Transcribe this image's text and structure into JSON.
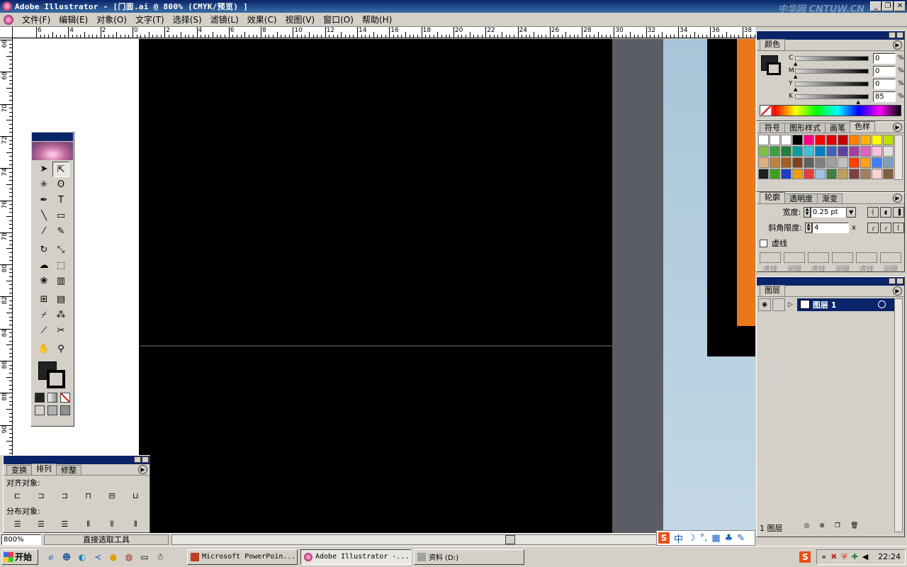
{
  "window": {
    "title": "Adobe Illustrator - [门面.ai @ 800% (CMYK/预览) ]",
    "watermark": "中华网 CNTUW.CN",
    "btn_min": "_",
    "btn_restore": "❐",
    "btn_close": "✕"
  },
  "menu": {
    "items": [
      {
        "label": "文件(F)"
      },
      {
        "label": "编辑(E)"
      },
      {
        "label": "对象(O)"
      },
      {
        "label": "文字(T)"
      },
      {
        "label": "选择(S)"
      },
      {
        "label": "滤镜(L)"
      },
      {
        "label": "效果(C)"
      },
      {
        "label": "视图(V)"
      },
      {
        "label": "窗口(O)"
      },
      {
        "label": "帮助(H)"
      }
    ]
  },
  "ruler_top": [
    "6",
    "4",
    "2",
    "0",
    "2",
    "4",
    "6",
    "8",
    "10",
    "12",
    "14",
    "16",
    "18",
    "20",
    "22",
    "24",
    "26",
    "28",
    "30",
    "32",
    "34",
    "36",
    "38"
  ],
  "ruler_left": [
    "66",
    "68",
    "70",
    "72",
    "74",
    "76",
    "78",
    "80",
    "82",
    "84",
    "86",
    "88",
    "90"
  ],
  "toolbox": {
    "tools": [
      {
        "name": "selection-tool",
        "glyph": "➤"
      },
      {
        "name": "direct-selection-tool",
        "glyph": "⇱"
      },
      {
        "name": "magic-wand-tool",
        "glyph": "✳"
      },
      {
        "name": "lasso-tool",
        "glyph": "ʘ"
      },
      {
        "name": "pen-tool",
        "glyph": "✒"
      },
      {
        "name": "type-tool",
        "glyph": "T"
      },
      {
        "name": "line-tool",
        "glyph": "╲"
      },
      {
        "name": "rectangle-tool",
        "glyph": "▭"
      },
      {
        "name": "paintbrush-tool",
        "glyph": "⁄"
      },
      {
        "name": "pencil-tool",
        "glyph": "✎"
      },
      {
        "name": "rotate-tool",
        "glyph": "↻"
      },
      {
        "name": "scale-tool",
        "glyph": "⤡"
      },
      {
        "name": "warp-tool",
        "glyph": "☁"
      },
      {
        "name": "free-transform-tool",
        "glyph": "⬚"
      },
      {
        "name": "symbol-sprayer-tool",
        "glyph": "❀"
      },
      {
        "name": "graph-tool",
        "glyph": "▥"
      },
      {
        "name": "mesh-tool",
        "glyph": "⊞"
      },
      {
        "name": "gradient-tool",
        "glyph": "▤"
      },
      {
        "name": "eyedropper-tool",
        "glyph": "⌿"
      },
      {
        "name": "blend-tool",
        "glyph": "⁂"
      },
      {
        "name": "slice-tool",
        "glyph": "⟋"
      },
      {
        "name": "scissors-tool",
        "glyph": "✂"
      },
      {
        "name": "hand-tool",
        "glyph": "✋"
      },
      {
        "name": "zoom-tool",
        "glyph": "⚲"
      }
    ]
  },
  "align_panel": {
    "tabs": [
      "变换",
      "排列",
      "修整"
    ],
    "align_label": "对齐对象:",
    "distribute_label": "分布对象:",
    "panel_arrow": "▶",
    "align_icons": [
      "⊏",
      "⊐",
      "⊐",
      "⊓",
      "⊟",
      "⊔"
    ],
    "distribute_icons": [
      "☰",
      "☰",
      "☰",
      "⫴",
      "⫴",
      "⫴"
    ]
  },
  "status": {
    "zoom": "800%",
    "tool": "直接选取工具"
  },
  "ime": {
    "s": "S",
    "zh": "中",
    "moon": "☽",
    "dot": "°,",
    "kb": "▦",
    "pen": "♣",
    "wrench": "✎"
  },
  "color_panel": {
    "title": "颜色",
    "channels": [
      {
        "label": "C",
        "value": "0"
      },
      {
        "label": "M",
        "value": "0"
      },
      {
        "label": "Y",
        "value": "0"
      },
      {
        "label": "K",
        "value": "85"
      }
    ],
    "pct": "%"
  },
  "swatch_panel": {
    "tabs": [
      "符号",
      "图形样式",
      "画笔",
      "色样"
    ],
    "swatches": [
      "#ffffff",
      "#ffffff",
      "#ffffff",
      "#000000",
      "#ff0080",
      "#ff0000",
      "#e00000",
      "#c00000",
      "#ff8000",
      "#ffb000",
      "#ffff00",
      "#c0e000",
      "#80c040",
      "#40a040",
      "#208040",
      "#00a0a0",
      "#40c0e0",
      "#0080c0",
      "#4060c0",
      "#6040a0",
      "#a040a0",
      "#e060c0",
      "#ffc0e0",
      "#e0e0e0",
      "#e0b080",
      "#c08040",
      "#a06020",
      "#804020",
      "#606060",
      "#808080",
      "#a0a0a0",
      "#c0c0c0",
      "#ff4000",
      "#ffa020",
      "#4080ff",
      "#80a0c0",
      "#202020",
      "#40a020",
      "#2040c0",
      "#f0a000",
      "#e04040",
      "#a0c0e0",
      "#408040",
      "#c0a060",
      "#804040",
      "#a08060",
      "#ffd0d0",
      "#806040"
    ]
  },
  "stroke_panel": {
    "tabs": [
      "轮廓",
      "透明度",
      "渐变"
    ],
    "width_label": "宽度:",
    "width_value": "0.25 pt",
    "miter_label": "斜角限度:",
    "miter_value": "4",
    "miter_unit": "x",
    "dashed_label": "虚线",
    "dash_labels": [
      "虚线",
      "间隔",
      "虚线",
      "间隔",
      "虚线",
      "间隔"
    ]
  },
  "layers_panel": {
    "tab": "图层",
    "layer_name": "图层 1",
    "footer_count": "1 图层"
  },
  "taskbar": {
    "start": "开始",
    "tasks": [
      "Microsoft PowerPoin...",
      "Adobe Illustrator -...",
      "资料 (D:)"
    ],
    "clock": "22:24"
  }
}
